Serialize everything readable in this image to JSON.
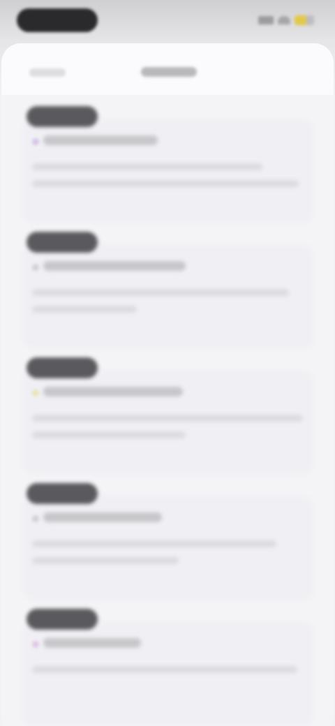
{
  "status_bar": {
    "time": "",
    "icons": [
      "signal-icon",
      "wifi-icon",
      "battery-icon"
    ],
    "battery_color": "#e2c84a"
  },
  "nav": {
    "left_label": "",
    "title": ""
  },
  "items": [
    {
      "date": "",
      "title": "",
      "line1": "",
      "line2": "",
      "dot_color": "#d7c2e8"
    },
    {
      "date": "",
      "title": "",
      "line1": "",
      "line2": "",
      "dot_color": "#d0d0d6"
    },
    {
      "date": "",
      "title": "",
      "line1": "",
      "line2": "",
      "dot_color": "#ece2b8"
    },
    {
      "date": "",
      "title": "",
      "line1": "",
      "line2": "",
      "dot_color": "#d0d0d6"
    },
    {
      "date": "",
      "title": "",
      "line1": "",
      "line2": "",
      "dot_color": "#e2c4e6"
    }
  ]
}
